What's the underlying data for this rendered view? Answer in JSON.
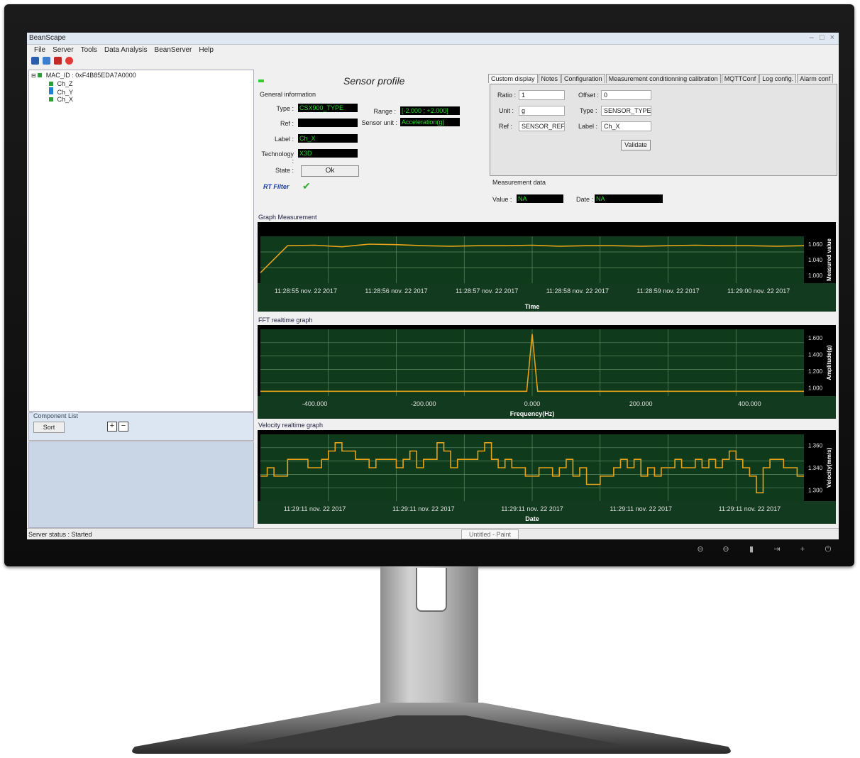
{
  "app": {
    "title": "BeanScape",
    "window_buttons": [
      "–",
      "□",
      "×"
    ]
  },
  "menu": [
    "File",
    "Server",
    "Tools",
    "Data Analysis",
    "BeanServer",
    "Help"
  ],
  "tree": {
    "root": "MAC_ID : 0xF4B85EDA7A0000",
    "children": [
      "Ch_Z",
      "Ch_Y",
      "Ch_X"
    ]
  },
  "component_list": {
    "label": "Component List",
    "sort_label": "Sort",
    "plus": "+",
    "minus": "−"
  },
  "status": {
    "server": "Server status : Started",
    "doc": "Untitled - Paint"
  },
  "sensor_profile": {
    "title": "Sensor profile",
    "general_info": "General information",
    "fields": {
      "type_label": "Type :",
      "type_value": "CSX900_TYPE",
      "ref_label": "Ref :",
      "ref_value": "",
      "label_label": "Label :",
      "label_value": "Ch_X",
      "tech_label": "Technology :",
      "tech_value": "X3D",
      "state_label": "State :",
      "state_value": "Ok",
      "range_label": "Range :",
      "range_value": "[-2.000 ; +2.000]",
      "unit_label": "Sensor unit :",
      "unit_value": "Acceleration(g)"
    },
    "rt_filter": "RT Filter"
  },
  "tabs": [
    "Custom display",
    "Notes",
    "Configuration",
    "Measurement conditionning calibration",
    "MQTTConf",
    "Log config.",
    "Alarm conf"
  ],
  "custom_display": {
    "ratio_label": "Ratio :",
    "ratio_value": "1",
    "offset_label": "Offset :",
    "offset_value": "0",
    "unit_label": "Unit :",
    "unit_value": "g",
    "type_label": "Type :",
    "type_value": "SENSOR_TYPE",
    "ref_label": "Ref :",
    "ref_value": "SENSOR_REF",
    "label_label": "Label :",
    "label_value": "Ch_X",
    "validate": "Validate"
  },
  "measurement": {
    "title": "Measurement data",
    "value_label": "Value :",
    "value": "NA",
    "date_label": "Date :",
    "date": "NA"
  },
  "graphs": {
    "g1": {
      "title": "Graph Measurement",
      "xlabel": "Time",
      "ylabel": "Measured value",
      "xticks": [
        "11:28:55 nov. 22 2017",
        "11:28:56 nov. 22 2017",
        "11:28:57 nov. 22 2017",
        "11:28:58 nov. 22 2017",
        "11:28:59 nov. 22 2017",
        "11:29:00 nov. 22 2017"
      ],
      "yticks": [
        "1.060",
        "1.040",
        "1.000"
      ]
    },
    "g2": {
      "title": "FFT realtime graph",
      "xlabel": "Frequency(Hz)",
      "ylabel": "Amplitude(g)",
      "xticks": [
        "-400.000",
        "-200.000",
        "0.000",
        "200.000",
        "400.000"
      ],
      "yticks": [
        "1.600",
        "1.400",
        "1.200",
        "1.000"
      ]
    },
    "g3": {
      "title": "Velocity realtime graph",
      "xlabel": "Date",
      "ylabel": "Velocity(mm/s)",
      "xticks": [
        "11:29:11 nov. 22 2017",
        "11:29:11 nov. 22 2017",
        "11:29:11 nov. 22 2017",
        "11:29:11 nov. 22 2017",
        "11:29:11 nov. 22 2017"
      ],
      "yticks": [
        "1.360",
        "1.340",
        "1.300"
      ]
    }
  },
  "chart_data": [
    {
      "type": "line",
      "title": "Graph Measurement",
      "xlabel": "Time",
      "ylabel": "Measured value",
      "x": [
        0,
        1,
        2,
        3,
        4,
        5,
        6,
        7,
        8,
        9,
        10,
        11,
        12,
        13,
        14,
        15,
        16,
        17,
        18,
        19,
        20
      ],
      "values": [
        1.0,
        1.052,
        1.053,
        1.05,
        1.055,
        1.054,
        1.052,
        1.051,
        1.052,
        1.052,
        1.053,
        1.051,
        1.052,
        1.052,
        1.051,
        1.052,
        1.053,
        1.052,
        1.052,
        1.051,
        1.052
      ],
      "ylim": [
        0.98,
        1.07
      ]
    },
    {
      "type": "line",
      "title": "FFT realtime graph",
      "xlabel": "Frequency(Hz)",
      "ylabel": "Amplitude(g)",
      "x": [
        -500,
        -400,
        -300,
        -200,
        -100,
        -20,
        -10,
        0,
        10,
        20,
        100,
        200,
        300,
        400,
        500
      ],
      "values": [
        1.0,
        1.0,
        1.0,
        1.0,
        1.0,
        1.0,
        1.0,
        1.6,
        1.0,
        1.0,
        1.0,
        1.0,
        1.0,
        1.0,
        1.0
      ],
      "ylim": [
        0.95,
        1.65
      ]
    },
    {
      "type": "line",
      "title": "Velocity realtime graph",
      "xlabel": "Date",
      "ylabel": "Velocity(mm/s)",
      "values": [
        1.32,
        1.33,
        1.32,
        1.32,
        1.34,
        1.34,
        1.34,
        1.33,
        1.33,
        1.34,
        1.35,
        1.36,
        1.35,
        1.35,
        1.34,
        1.34,
        1.33,
        1.34,
        1.34,
        1.34,
        1.33,
        1.34,
        1.35,
        1.33,
        1.34,
        1.34,
        1.36,
        1.35,
        1.33,
        1.34,
        1.34,
        1.34,
        1.35,
        1.36,
        1.34,
        1.33,
        1.34,
        1.33,
        1.33,
        1.32,
        1.32,
        1.33,
        1.33,
        1.32,
        1.33,
        1.34,
        1.32,
        1.33,
        1.31,
        1.31,
        1.32,
        1.32,
        1.33,
        1.34,
        1.33,
        1.34,
        1.32,
        1.33,
        1.32,
        1.33,
        1.33,
        1.34,
        1.33,
        1.33,
        1.34,
        1.33,
        1.34,
        1.33,
        1.34,
        1.35,
        1.34,
        1.33,
        1.32,
        1.3,
        1.33,
        1.34,
        1.34,
        1.33,
        1.33,
        1.32,
        1.32
      ],
      "ylim": [
        1.29,
        1.37
      ]
    }
  ],
  "colors": {
    "plot_bg": "#0f3a1c",
    "grid": "#5d8a63",
    "line": "#e6a21a",
    "readout_text": "#27d827"
  }
}
